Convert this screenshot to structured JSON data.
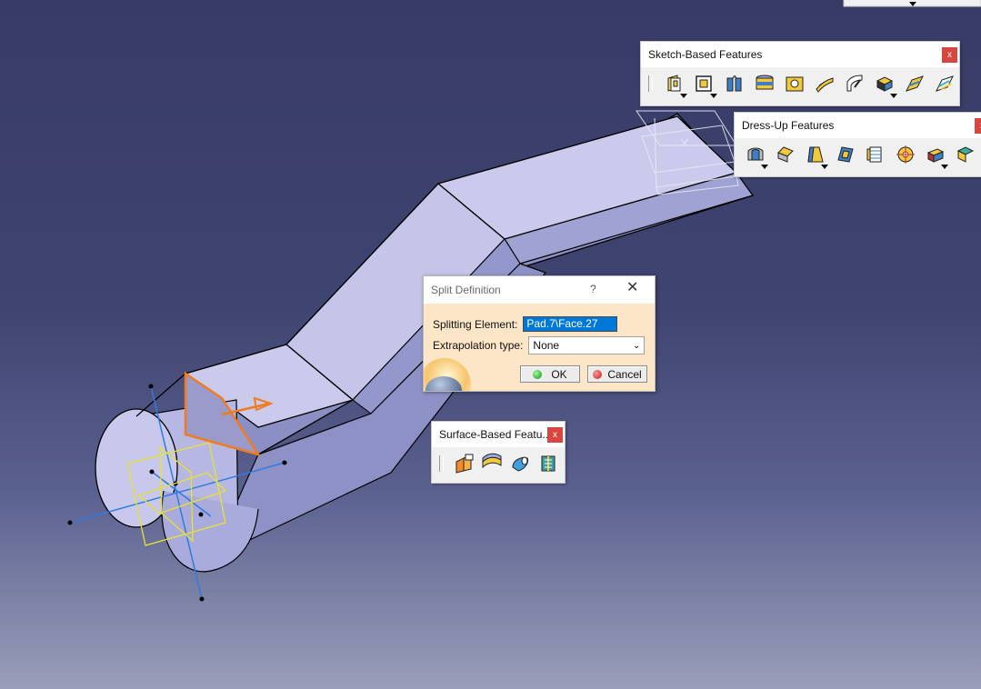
{
  "toolbars": {
    "sketch_based": {
      "title": "Sketch-Based Features",
      "close": "x"
    },
    "dress_up": {
      "title": "Dress-Up Features",
      "close": "x"
    },
    "surface_based": {
      "title": "Surface-Based Featu...",
      "close": "x"
    }
  },
  "split_dialog": {
    "title": "Split Definition",
    "help": "?",
    "splitting_element_label": "Splitting Element:",
    "splitting_element_value": "Pad.7\\Face.27",
    "extrapolation_label": "Extrapolation type:",
    "extrapolation_value": "None",
    "ok_label": "OK",
    "cancel_label": "Cancel"
  },
  "colors": {
    "background_top": "#383b66",
    "part_face": "#c6c7ec",
    "selection_orange": "#f07c1e",
    "axis_blue": "#2f7be0",
    "plane_yellow": "#e8e230"
  }
}
